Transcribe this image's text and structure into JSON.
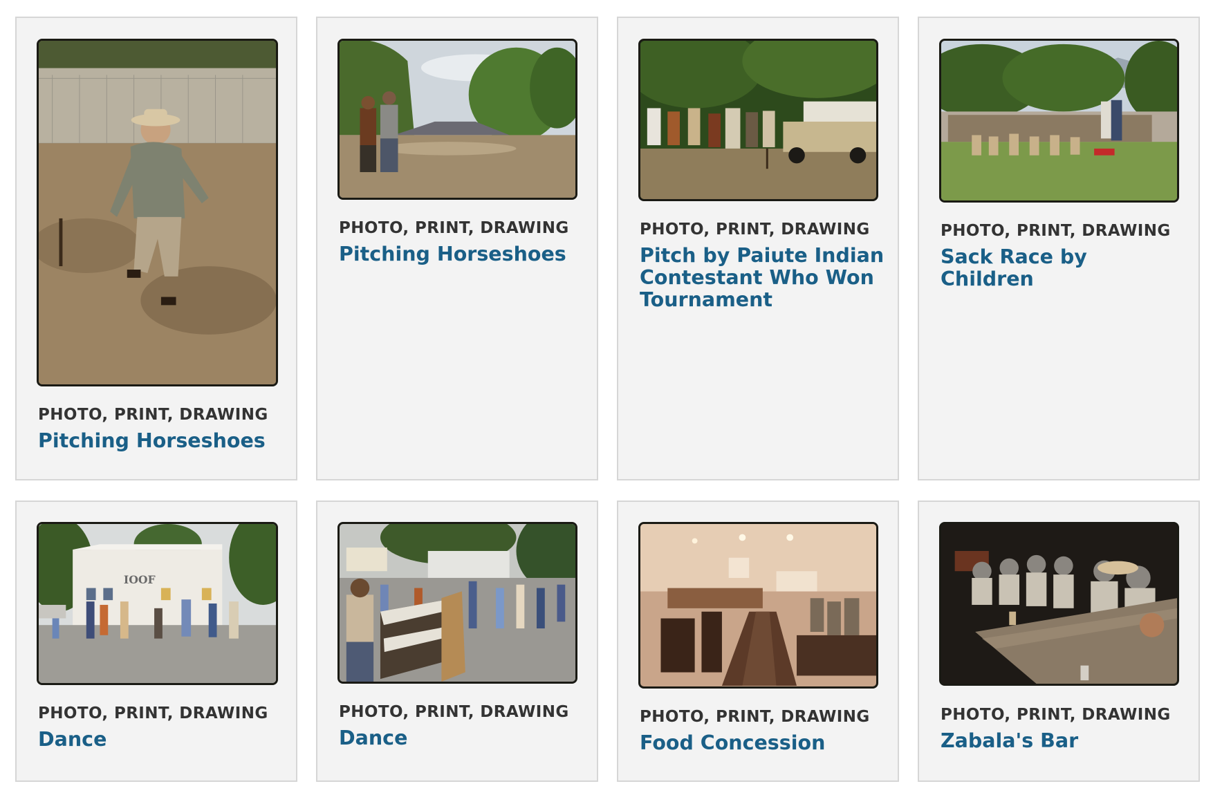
{
  "items": [
    {
      "format": "PHOTO, PRINT, DRAWING",
      "title": "Pitching Horseshoes"
    },
    {
      "format": "PHOTO, PRINT, DRAWING",
      "title": "Pitching Horseshoes"
    },
    {
      "format": "PHOTO, PRINT, DRAWING",
      "title": "Pitch by Paiute Indian Contestant Who Won Tournament"
    },
    {
      "format": "PHOTO, PRINT, DRAWING",
      "title": "Sack Race by Children"
    },
    {
      "format": "PHOTO, PRINT, DRAWING",
      "title": "Dance"
    },
    {
      "format": "PHOTO, PRINT, DRAWING",
      "title": "Dance"
    },
    {
      "format": "PHOTO, PRINT, DRAWING",
      "title": "Food Concession"
    },
    {
      "format": "PHOTO, PRINT, DRAWING",
      "title": "Zabala's Bar"
    }
  ],
  "colors": {
    "card_background": "#f3f3f3",
    "card_border": "#d6d6d6",
    "title_link": "#1a5f87",
    "format_text": "#333333"
  }
}
